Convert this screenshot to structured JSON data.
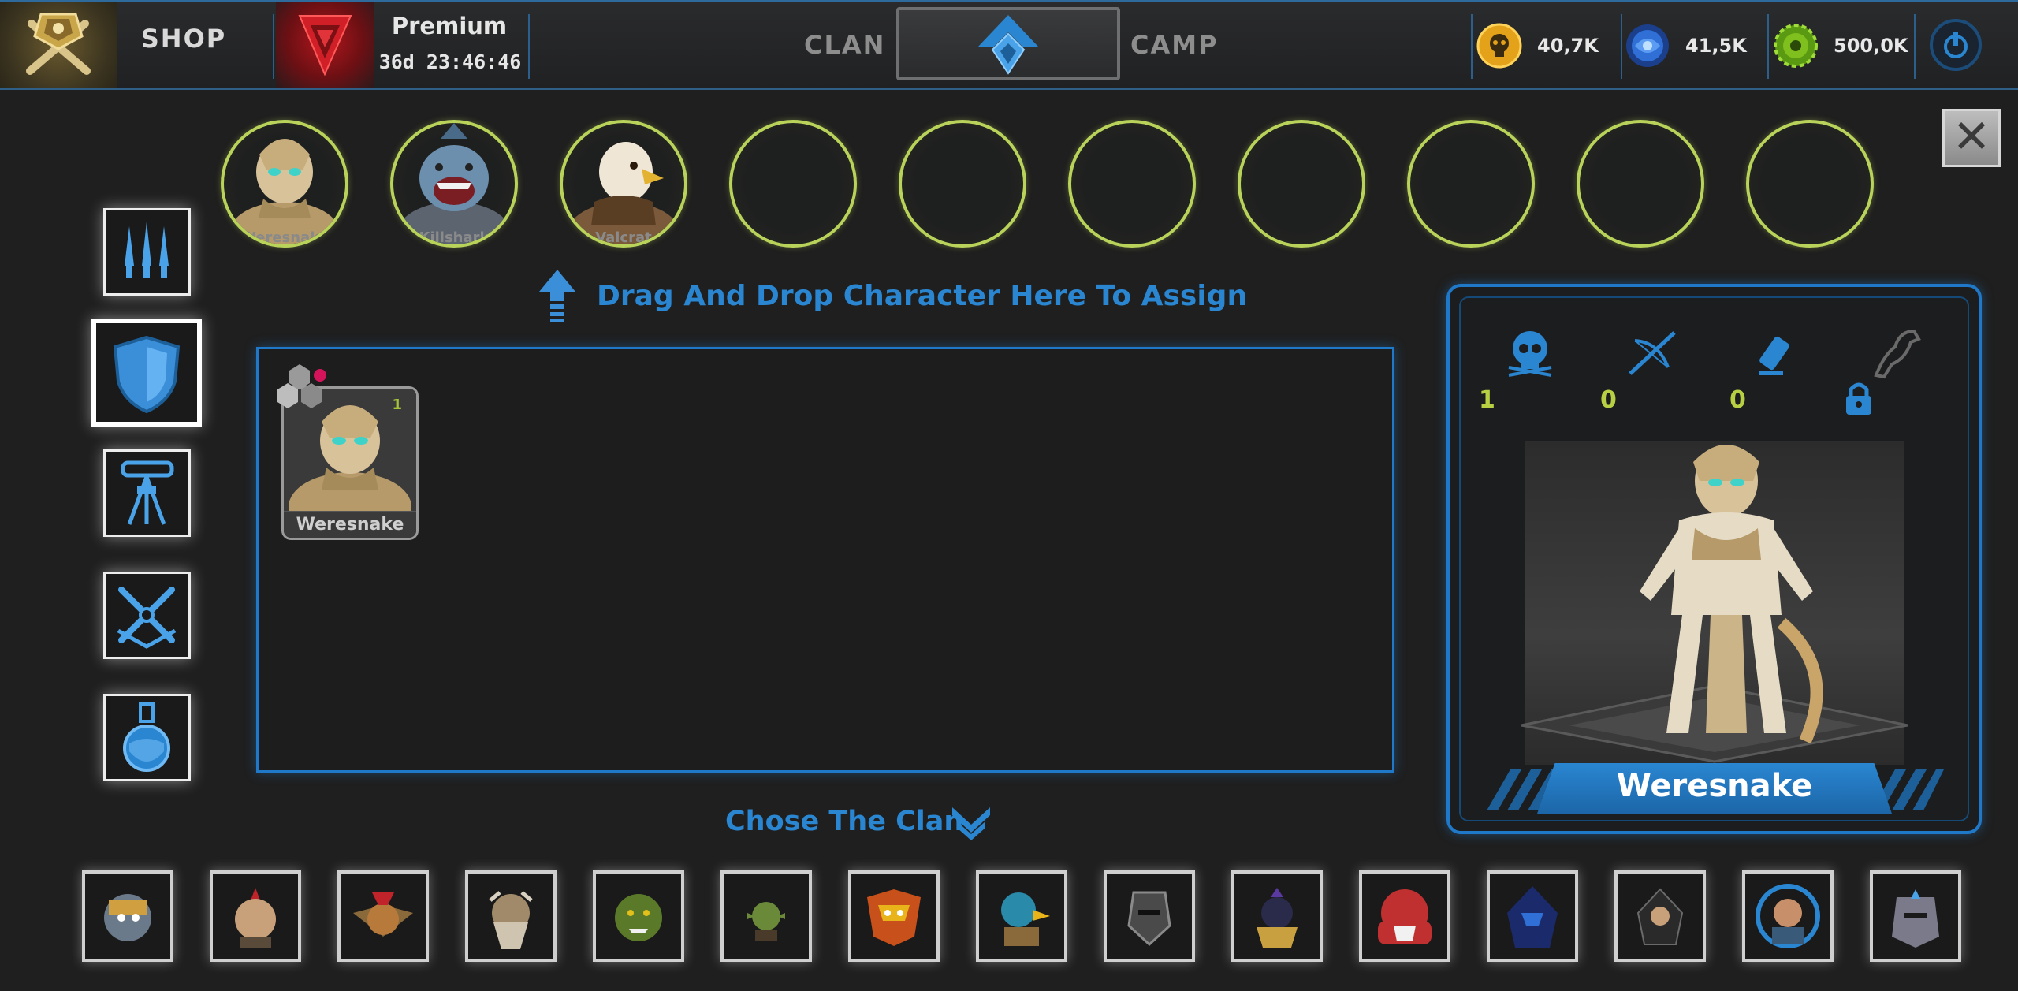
{
  "topbar": {
    "shop_label": "SHOP",
    "premium_title": "Premium",
    "premium_timer": "36d 23:46:46",
    "nav_clan": "CLAN",
    "nav_camp": "CAMP",
    "resources": [
      {
        "icon": "skull-coin-icon",
        "value": "40,7K",
        "color": "#e3a21a"
      },
      {
        "icon": "blue-orb-icon",
        "value": "41,5K",
        "color": "#2f6fd6"
      },
      {
        "icon": "green-gear-icon",
        "value": "500,0K",
        "color": "#7fbf1e"
      }
    ]
  },
  "slots": [
    {
      "name": "Weresnake",
      "filled": true
    },
    {
      "name": "Killshark",
      "filled": true
    },
    {
      "name": "Valcrat",
      "filled": true
    },
    {
      "filled": false
    },
    {
      "filled": false
    },
    {
      "filled": false
    },
    {
      "filled": false
    },
    {
      "filled": false
    },
    {
      "filled": false
    },
    {
      "filled": false
    }
  ],
  "drag_hint": "Drag  And Drop Character Here To Assign",
  "character_card": {
    "name": "Weresnake",
    "level": "1"
  },
  "info_panel": {
    "stats": [
      {
        "icon": "skull-icon",
        "value": "1"
      },
      {
        "icon": "crossbow-icon",
        "value": "0"
      },
      {
        "icon": "cannon-icon",
        "value": "0"
      },
      {
        "icon": "horse-icon",
        "value": "",
        "locked": true
      }
    ],
    "hero_name": "Weresnake"
  },
  "clan_title": "Chose The Clan",
  "clans": [
    "clan-dwarf-mech",
    "clan-spartan",
    "clan-goblin-red",
    "clan-viking-elder",
    "clan-orc-green",
    "clan-goblin-small",
    "clan-dragon-mask",
    "clan-bird-knight",
    "clan-dark-knight",
    "clan-armored-bird",
    "clan-red-giant",
    "clan-blue-hood",
    "clan-assassin",
    "clan-soldier",
    "clan-steel-helm"
  ],
  "colors": {
    "accent": "#2a86d1",
    "slot_ring": "#b9d35a",
    "stat_value": "#b6cf43"
  }
}
